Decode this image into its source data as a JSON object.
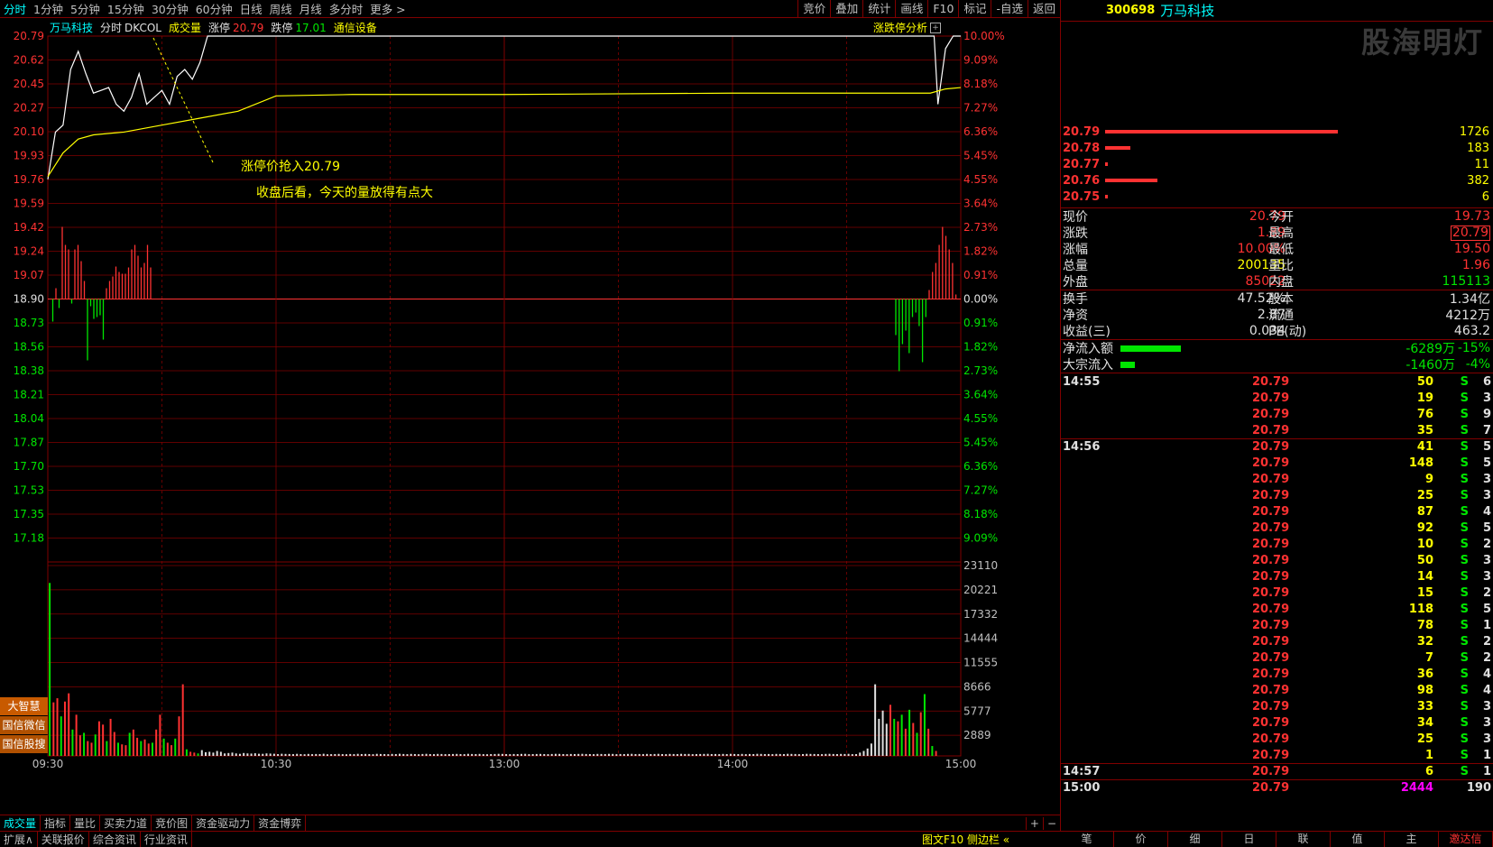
{
  "toolbar": {
    "periods": [
      "分时",
      "1分钟",
      "5分钟",
      "15分钟",
      "30分钟",
      "60分钟",
      "日线",
      "周线",
      "月线",
      "多分时",
      "更多 >"
    ],
    "right_buttons": [
      "竞价",
      "叠加",
      "统计",
      "画线",
      "F10",
      "标记",
      "-自选",
      "返回"
    ]
  },
  "title": {
    "name": "万马科技",
    "mode": "分时",
    "indicator": "DKCOL",
    "vol_label": "成交量",
    "up_limit_label": "涨停",
    "up_limit": "20.79",
    "down_limit_label": "跌停",
    "down_limit": "17.01",
    "sector": "通信设备",
    "analysis": "涨跌停分析"
  },
  "annotations": {
    "a1": "涨停价抢入20.79",
    "a2": "收盘后看，今天的量放得有点大"
  },
  "side_buttons": [
    "大智慧",
    "国信微信",
    "国信股搜"
  ],
  "bottom_tabs": [
    "成交量",
    "指标",
    "量比",
    "买卖力道",
    "竞价图",
    "资金驱动力",
    "资金博弈"
  ],
  "bottom_tab_icons": [
    "+",
    "−"
  ],
  "bottom_bar": [
    "扩展∧",
    "关联报价",
    "综合资讯",
    "行业资讯"
  ],
  "bottom_bar_right": "图文F10 侧边栏 «",
  "chart_data": {
    "type": "line",
    "price_ticks": [
      "20.79",
      "20.62",
      "20.45",
      "20.27",
      "20.10",
      "19.93",
      "19.76",
      "19.59",
      "19.42",
      "19.24",
      "19.07",
      "18.90",
      "18.73",
      "18.56",
      "18.38",
      "18.21",
      "18.04",
      "17.87",
      "17.70",
      "17.53",
      "17.35",
      "17.18"
    ],
    "pct_ticks": [
      "10.00%",
      "9.09%",
      "8.18%",
      "7.27%",
      "6.36%",
      "5.45%",
      "4.55%",
      "3.64%",
      "2.73%",
      "1.82%",
      "0.91%",
      "0.00%",
      "0.91%",
      "1.82%",
      "2.73%",
      "3.64%",
      "4.55%",
      "5.45%",
      "6.36%",
      "7.27%",
      "8.18%",
      "9.09%"
    ],
    "vol_ticks": [
      "23110",
      "20221",
      "17332",
      "14444",
      "11555",
      "8666",
      "5777",
      "2889"
    ],
    "time_ticks": [
      "09:30",
      "10:30",
      "13:00",
      "14:00",
      "15:00"
    ],
    "price_series": [
      [
        0,
        19.76
      ],
      [
        2,
        20.1
      ],
      [
        4,
        20.15
      ],
      [
        6,
        20.55
      ],
      [
        8,
        20.68
      ],
      [
        10,
        20.52
      ],
      [
        12,
        20.38
      ],
      [
        14,
        20.4
      ],
      [
        16,
        20.42
      ],
      [
        18,
        20.3
      ],
      [
        20,
        20.25
      ],
      [
        22,
        20.35
      ],
      [
        24,
        20.52
      ],
      [
        26,
        20.3
      ],
      [
        28,
        20.35
      ],
      [
        30,
        20.4
      ],
      [
        32,
        20.3
      ],
      [
        34,
        20.5
      ],
      [
        36,
        20.55
      ],
      [
        38,
        20.48
      ],
      [
        40,
        20.6
      ],
      [
        42,
        20.79
      ],
      [
        70,
        20.79
      ],
      [
        160,
        20.79
      ],
      [
        233,
        20.79
      ],
      [
        234,
        20.3
      ],
      [
        235,
        20.5
      ],
      [
        236,
        20.7
      ],
      [
        238,
        20.79
      ],
      [
        240,
        20.79
      ]
    ],
    "avg_series": [
      [
        0,
        19.78
      ],
      [
        4,
        19.95
      ],
      [
        8,
        20.05
      ],
      [
        12,
        20.08
      ],
      [
        20,
        20.1
      ],
      [
        30,
        20.15
      ],
      [
        40,
        20.2
      ],
      [
        50,
        20.25
      ],
      [
        60,
        20.36
      ],
      [
        80,
        20.37
      ],
      [
        120,
        20.37
      ],
      [
        180,
        20.38
      ],
      [
        228,
        20.38
      ],
      [
        232,
        20.38
      ],
      [
        236,
        20.41
      ],
      [
        240,
        20.42
      ]
    ],
    "vol_series": [
      21000,
      6500,
      7000,
      4800,
      6600,
      7600,
      3200,
      5000,
      2500,
      2800,
      1800,
      1600,
      2600,
      4200,
      3800,
      1800,
      4500,
      2900,
      1600,
      1400,
      1300,
      2800,
      3200,
      2200,
      1800,
      2000,
      1500,
      1600,
      3200,
      5000,
      2100,
      1600,
      1300,
      2100,
      4800,
      8700,
      800,
      500,
      400,
      300,
      700,
      450,
      500,
      400,
      600,
      500,
      300,
      350,
      400,
      300,
      250,
      350,
      300,
      280,
      320,
      260,
      250,
      300,
      280,
      260,
      220,
      260,
      240,
      230,
      210,
      250,
      220,
      200,
      240,
      210,
      230,
      220,
      260,
      200,
      210,
      220,
      240,
      210,
      200,
      230,
      210,
      250,
      220,
      240,
      220,
      200,
      250,
      230,
      220,
      210,
      240,
      220,
      260,
      230,
      210,
      240,
      220,
      200,
      230,
      250,
      220,
      210,
      240,
      230,
      210,
      220,
      230,
      240,
      220,
      210,
      250,
      230,
      220,
      240,
      210,
      200,
      220,
      230,
      250,
      240,
      220,
      210,
      230,
      220,
      240,
      250,
      210,
      220,
      230,
      240,
      220,
      210,
      230,
      250,
      240,
      220,
      210,
      230,
      220,
      240,
      250,
      230,
      220,
      210,
      240,
      230,
      220,
      250,
      240,
      210,
      230,
      220,
      240,
      250,
      220,
      230,
      210,
      240,
      220,
      230,
      250,
      220,
      210,
      240,
      230,
      220,
      250,
      230,
      240,
      210,
      220,
      230,
      240,
      250,
      220,
      230,
      210,
      240,
      220,
      250,
      230,
      220,
      240,
      210,
      230,
      220,
      250,
      240,
      220,
      230,
      210,
      240,
      230,
      220,
      250,
      240,
      230,
      210,
      220,
      250,
      240,
      230,
      220,
      210,
      240,
      250,
      230,
      220,
      240,
      230,
      250,
      210,
      220,
      400,
      600,
      900,
      1500,
      8700,
      4500,
      5500,
      3900,
      6200,
      4500,
      4200,
      5000,
      3300,
      5600,
      4000,
      2800,
      5300,
      7500,
      3300,
      1200,
      600
    ]
  },
  "right": {
    "code": "300698",
    "name": "万马科技",
    "book": [
      {
        "price": "20.79",
        "vol": "1726",
        "w": 258
      },
      {
        "price": "20.78",
        "vol": "183",
        "w": 28
      },
      {
        "price": "20.77",
        "vol": "11",
        "w": 3
      },
      {
        "price": "20.76",
        "vol": "382",
        "w": 58
      },
      {
        "price": "20.75",
        "vol": "6",
        "w": 3
      }
    ],
    "quote": [
      {
        "l": "现价",
        "v": "20.79",
        "c": "red",
        "l2": "今开",
        "v2": "19.73",
        "c2": "red"
      },
      {
        "l": "涨跌",
        "v": "1.89",
        "c": "red",
        "l2": "最高",
        "v2": "20.79",
        "c2": "red",
        "box": true
      },
      {
        "l": "涨幅",
        "v": "10.00%",
        "c": "red",
        "l2": "最低",
        "v2": "19.50",
        "c2": "red"
      },
      {
        "l": "总量",
        "v": "200135",
        "c": "yellow",
        "l2": "量比",
        "v2": "1.96",
        "c2": "red"
      },
      {
        "l": "外盘",
        "v": "85022",
        "c": "red",
        "l2": "内盘",
        "v2": "115113",
        "c2": "green"
      }
    ],
    "quote2": [
      {
        "l": "换手",
        "v": "47.52%",
        "l2": "股本",
        "v2": "1.34亿"
      },
      {
        "l": "净资",
        "v": "2.87",
        "l2": "流通",
        "v2": "4212万"
      },
      {
        "l": "收益(三)",
        "v": "0.034",
        "l2": "PE(动)",
        "v2": "463.2"
      }
    ],
    "flows": [
      {
        "l": "净流入额",
        "v": "-6289万",
        "p": "-15%",
        "w": 67
      },
      {
        "l": "大宗流入",
        "v": "-1460万",
        "p": "-4%",
        "w": 16
      }
    ],
    "ticks": [
      {
        "t": "14:55",
        "p": "20.79",
        "v": "50",
        "s": "S",
        "n": "6"
      },
      {
        "t": "",
        "p": "20.79",
        "v": "19",
        "s": "S",
        "n": "3"
      },
      {
        "t": "",
        "p": "20.79",
        "v": "76",
        "s": "S",
        "n": "9"
      },
      {
        "t": "",
        "p": "20.79",
        "v": "35",
        "s": "S",
        "n": "7"
      },
      {
        "t": "14:56",
        "p": "20.79",
        "v": "41",
        "s": "S",
        "n": "5"
      },
      {
        "t": "",
        "p": "20.79",
        "v": "148",
        "s": "S",
        "n": "5"
      },
      {
        "t": "",
        "p": "20.79",
        "v": "9",
        "s": "S",
        "n": "3"
      },
      {
        "t": "",
        "p": "20.79",
        "v": "25",
        "s": "S",
        "n": "3"
      },
      {
        "t": "",
        "p": "20.79",
        "v": "87",
        "s": "S",
        "n": "4"
      },
      {
        "t": "",
        "p": "20.79",
        "v": "92",
        "s": "S",
        "n": "5"
      },
      {
        "t": "",
        "p": "20.79",
        "v": "10",
        "s": "S",
        "n": "2"
      },
      {
        "t": "",
        "p": "20.79",
        "v": "50",
        "s": "S",
        "n": "3"
      },
      {
        "t": "",
        "p": "20.79",
        "v": "14",
        "s": "S",
        "n": "3"
      },
      {
        "t": "",
        "p": "20.79",
        "v": "15",
        "s": "S",
        "n": "2"
      },
      {
        "t": "",
        "p": "20.79",
        "v": "118",
        "s": "S",
        "n": "5"
      },
      {
        "t": "",
        "p": "20.79",
        "v": "78",
        "s": "S",
        "n": "1"
      },
      {
        "t": "",
        "p": "20.79",
        "v": "32",
        "s": "S",
        "n": "2"
      },
      {
        "t": "",
        "p": "20.79",
        "v": "7",
        "s": "S",
        "n": "2"
      },
      {
        "t": "",
        "p": "20.79",
        "v": "36",
        "s": "S",
        "n": "4"
      },
      {
        "t": "",
        "p": "20.79",
        "v": "98",
        "s": "S",
        "n": "4"
      },
      {
        "t": "",
        "p": "20.79",
        "v": "33",
        "s": "S",
        "n": "3"
      },
      {
        "t": "",
        "p": "20.79",
        "v": "34",
        "s": "S",
        "n": "3"
      },
      {
        "t": "",
        "p": "20.79",
        "v": "25",
        "s": "S",
        "n": "3"
      },
      {
        "t": "",
        "p": "20.79",
        "v": "1",
        "s": "S",
        "n": "1"
      },
      {
        "t": "14:57",
        "p": "20.79",
        "v": "6",
        "s": "S",
        "n": "1"
      },
      {
        "t": "15:00",
        "p": "20.79",
        "v": "2444",
        "s": "",
        "n": "190",
        "last": true
      }
    ],
    "tabs": [
      "笔",
      "价",
      "细",
      "日",
      "联",
      "值",
      "主",
      "邀达信"
    ]
  },
  "watermark": "股海明灯"
}
